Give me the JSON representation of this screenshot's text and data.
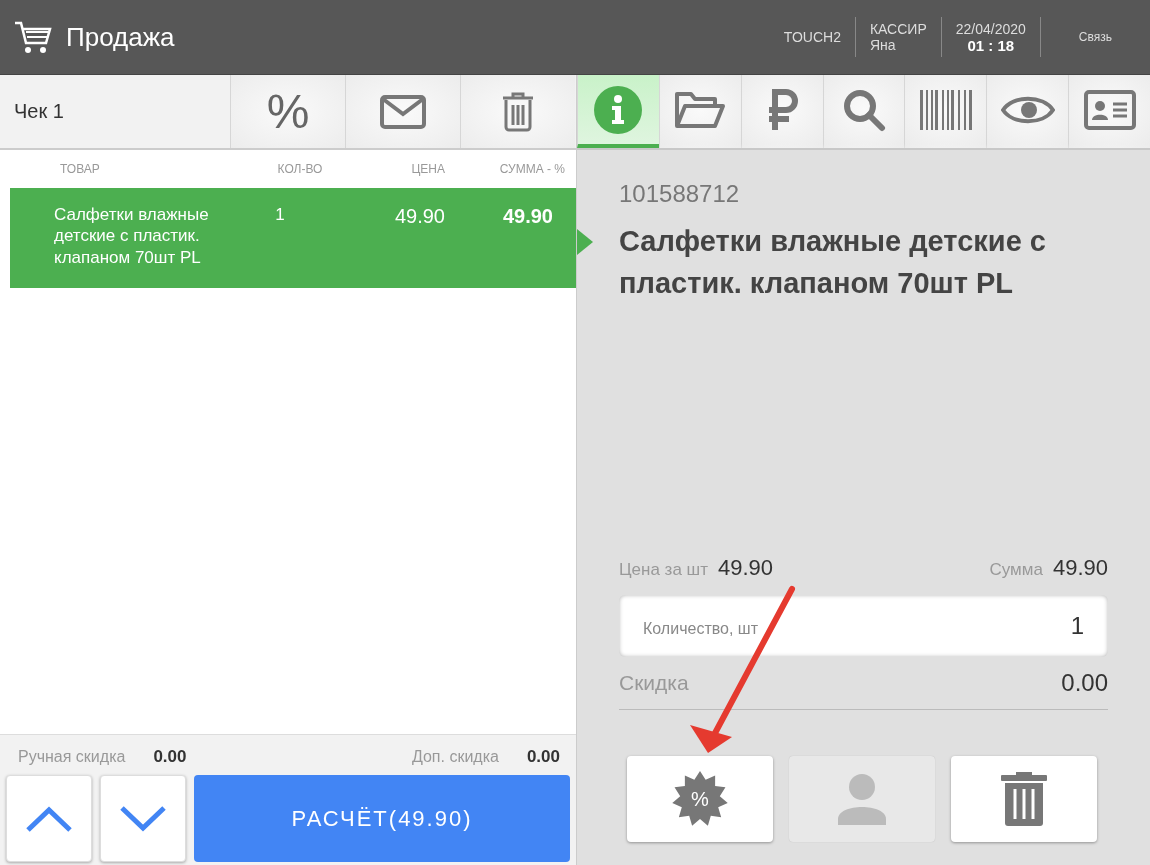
{
  "header": {
    "title": "Продажа",
    "terminal": "TOUCH2",
    "cashier_label": "КАССИР",
    "cashier_name": "Яна",
    "date": "22/04/2020",
    "time": "01 : 18",
    "link": "Связь"
  },
  "receipt": {
    "title": "Чек 1",
    "discount_symbol": "%",
    "columns": [
      "ТОВАР",
      "КОЛ-ВО",
      "ЦЕНА",
      "СУММА - %"
    ],
    "rows": [
      {
        "name": "Салфетки влажные детские с пластик. клапаном 70шт PL",
        "qty": "1",
        "price": "49.90",
        "sum": "49.90",
        "selected": true
      }
    ],
    "manual_discount_label": "Ручная скидка",
    "manual_discount": "0.00",
    "extra_discount_label": "Доп. скидка",
    "extra_discount": "0.00",
    "pay_button": "РАСЧЁТ(49.90)"
  },
  "tabs": [
    {
      "kind": "info",
      "selected": true
    },
    {
      "kind": "folder",
      "selected": false
    },
    {
      "kind": "ruble",
      "selected": false
    },
    {
      "kind": "search",
      "selected": false
    },
    {
      "kind": "barcode",
      "selected": false
    },
    {
      "kind": "eye",
      "selected": false
    },
    {
      "kind": "card",
      "selected": false
    }
  ],
  "product": {
    "code": "101588712",
    "name": "Салфетки влажные детские с пластик. клапаном 70шт PL",
    "unit_price_label": "Цена за шт",
    "unit_price": "49.90",
    "sum_label": "Сумма",
    "sum": "49.90",
    "qty_placeholder": "Количество, шт",
    "qty": "1",
    "discount_label": "Скидка",
    "discount": "0.00",
    "discount_badge": "%",
    "actions": [
      {
        "kind": "discount",
        "disabled": false
      },
      {
        "kind": "customer",
        "disabled": true
      },
      {
        "kind": "delete",
        "disabled": false
      }
    ]
  }
}
